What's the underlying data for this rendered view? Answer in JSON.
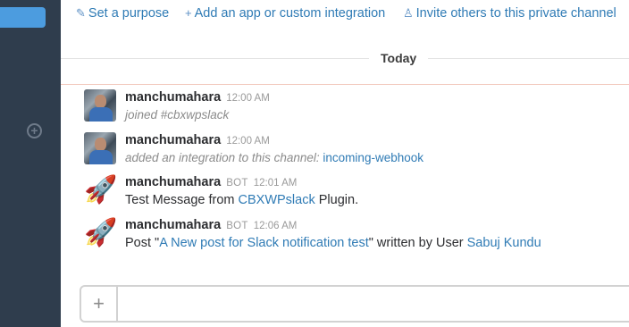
{
  "header": {
    "actions": [
      {
        "label": "Set a purpose",
        "icon": "pencil-icon"
      },
      {
        "label": "Add an app or custom integration",
        "icon": "plus-icon"
      },
      {
        "label": "Invite others to this private channel",
        "icon": "user-icon"
      }
    ]
  },
  "divider": {
    "label": "Today"
  },
  "messages": [
    {
      "author": "manchumahara",
      "time": "12:00 AM",
      "text": "joined #cbxwpslack",
      "avatar": "user-photo"
    },
    {
      "author": "manchumahara",
      "time": "12:00 AM",
      "text_prefix": "added an integration to this channel: ",
      "link": "incoming-webhook",
      "avatar": "user-photo"
    },
    {
      "author": "manchumahara",
      "badge": "BOT",
      "time": "12:01 AM",
      "text_prefix": "Test Message from ",
      "link": "CBXWPslack",
      "text_suffix": " Plugin.",
      "avatar": "rocket-icon"
    },
    {
      "author": "manchumahara",
      "badge": "BOT",
      "time": "12:06 AM",
      "text_prefix": "Post \"",
      "link": "A New post for Slack notification test",
      "text_mid": "\" written by User ",
      "link2": "Sabuj Kundu",
      "avatar": "rocket-icon"
    }
  ],
  "composer": {
    "plus_label": "+",
    "placeholder": ""
  },
  "sidebar": {
    "add_icon": "plus-circle-icon"
  },
  "colors": {
    "sidebar": "#2f3d4d",
    "accent": "#4c9cdf",
    "link": "#2f7bb5"
  }
}
